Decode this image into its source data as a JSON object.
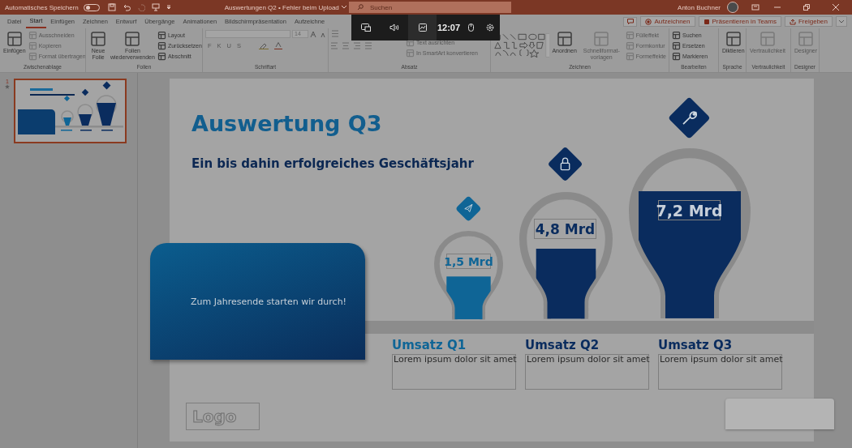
{
  "title_bar": {
    "autosave_label": "Automatisches Speichern",
    "autosave_on": false,
    "document_title": "Auswertungen Q2 • Fehler beim Upload",
    "search_placeholder": "Suchen",
    "user_name": "Anton Buchner"
  },
  "ribbon_tabs": [
    {
      "label": "Datei",
      "selected": false
    },
    {
      "label": "Start",
      "selected": true
    },
    {
      "label": "Einfügen",
      "selected": false
    },
    {
      "label": "Zeichnen",
      "selected": false
    },
    {
      "label": "Entwurf",
      "selected": false
    },
    {
      "label": "Übergänge",
      "selected": false
    },
    {
      "label": "Animationen",
      "selected": false
    },
    {
      "label": "Bildschirmpräsentation",
      "selected": false
    },
    {
      "label": "Aufzeichne",
      "selected": false
    }
  ],
  "ribbon_actions": [
    {
      "label": "Aufzeichnen",
      "kind": "record"
    },
    {
      "label": "Präsentieren in Teams",
      "kind": "teams"
    },
    {
      "label": "Freigeben",
      "kind": "share"
    }
  ],
  "ribbon_groups": [
    {
      "label": "Zwischenablage",
      "kind": "buttons",
      "items": [
        {
          "label": "Einfügen",
          "kind": "large",
          "disabled": false
        },
        {
          "label": "Ausschneiden",
          "kind": "small",
          "disabled": true
        },
        {
          "label": "Kopieren",
          "kind": "small",
          "disabled": true
        },
        {
          "label": "Format übertragen",
          "kind": "small",
          "disabled": true
        }
      ]
    },
    {
      "label": "Folien",
      "kind": "buttons",
      "items": [
        {
          "label": "Neue Folie",
          "kind": "large",
          "disabled": false
        },
        {
          "label": "Folien wiederverwenden",
          "kind": "large",
          "disabled": false
        },
        {
          "label": "Layout",
          "kind": "small",
          "disabled": false
        },
        {
          "label": "Zurücksetzen",
          "kind": "small",
          "disabled": false
        },
        {
          "label": "Abschnitt",
          "kind": "small",
          "disabled": false
        }
      ]
    },
    {
      "label": "Schriftart",
      "kind": "font",
      "font_size": "14",
      "format_buttons": [
        "F",
        "K",
        "U",
        "S"
      ]
    },
    {
      "label": "Absatz",
      "kind": "paragraph",
      "items": [
        {
          "label": "Text ausrichten",
          "kind": "small",
          "disabled": true
        },
        {
          "label": "In SmartArt konvertieren",
          "kind": "small",
          "disabled": true
        }
      ]
    },
    {
      "label": "Zeichnen",
      "kind": "drawing",
      "items": [
        {
          "label": "Anordnen",
          "kind": "large",
          "disabled": false
        },
        {
          "label": "Schnellformat-vorlagen",
          "kind": "large",
          "disabled": true
        },
        {
          "label": "Fülleffekt",
          "kind": "small",
          "disabled": true
        },
        {
          "label": "Formkontur",
          "kind": "small",
          "disabled": true
        },
        {
          "label": "Formeffekte",
          "kind": "small",
          "disabled": true
        }
      ]
    },
    {
      "label": "Bearbeiten",
      "kind": "buttons",
      "items": [
        {
          "label": "Suchen",
          "kind": "small",
          "disabled": false
        },
        {
          "label": "Ersetzen",
          "kind": "small",
          "disabled": false
        },
        {
          "label": "Markieren",
          "kind": "small",
          "disabled": false
        }
      ]
    },
    {
      "label": "Sprache",
      "kind": "buttons",
      "items": [
        {
          "label": "Diktieren",
          "kind": "large",
          "disabled": false
        }
      ]
    },
    {
      "label": "Vertraulichkeit",
      "kind": "buttons",
      "items": [
        {
          "label": "Vertraulichkeit",
          "kind": "large",
          "disabled": true
        }
      ]
    },
    {
      "label": "Designer",
      "kind": "buttons",
      "items": [
        {
          "label": "Designer",
          "kind": "large",
          "disabled": true
        }
      ]
    }
  ],
  "slides_pane": [
    {
      "number": "1",
      "selected": true,
      "animated": true
    }
  ],
  "slide": {
    "title": "Auswertung Q3",
    "subtitle": "Ein bis dahin erfolgreiches Geschäftsjahr",
    "card_text": "Zum Jahresende starten wir durch!",
    "logo": "Logo",
    "bulbs": [
      {
        "value": "1,5 Mrd",
        "level": 0.5,
        "color": "#0f6596",
        "label": "Umsatz Q1",
        "description": "Lorem ipsum dolor sit amet"
      },
      {
        "value": "4,8 Mrd",
        "level": 0.57,
        "color": "#0a2c5e",
        "label": "Umsatz Q2",
        "description": "Lorem ipsum dolor sit amet"
      },
      {
        "value": "7,2 Mrd",
        "level": 0.77,
        "color": "#0a2c5e",
        "label": "Umsatz Q3",
        "description": "Lorem ipsum dolor sit amet"
      }
    ]
  },
  "game_bar": {
    "widgets": [
      {
        "kind": "capture",
        "selected": false
      },
      {
        "kind": "audio",
        "selected": false
      },
      {
        "kind": "performance",
        "selected": true
      },
      {
        "kind": "clock",
        "selected": false,
        "time": "12:07"
      },
      {
        "kind": "mouse",
        "selected": false
      },
      {
        "kind": "settings",
        "selected": false
      }
    ]
  }
}
